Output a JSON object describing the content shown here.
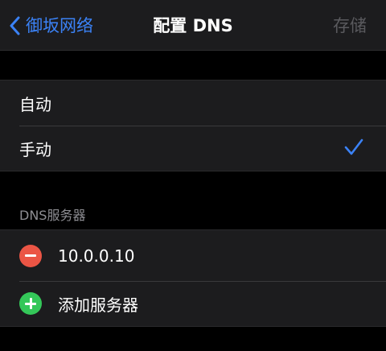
{
  "navbar": {
    "back_label": "御坂网络",
    "title": "配置 DNS",
    "save_label": "存储"
  },
  "mode": {
    "options": [
      {
        "label": "自动",
        "selected": false
      },
      {
        "label": "手动",
        "selected": true
      }
    ]
  },
  "dns": {
    "section_header": "DNS服务器",
    "servers": [
      "10.0.0.10"
    ],
    "add_label": "添加服务器"
  },
  "colors": {
    "accent": "#3b82f6",
    "delete": "#eb5545",
    "add": "#34c759",
    "disabled": "#5a5a5e"
  },
  "icons": {
    "back": "chevron-left-icon",
    "check": "checkmark-icon",
    "delete": "minus-circle-icon",
    "add": "plus-circle-icon"
  }
}
